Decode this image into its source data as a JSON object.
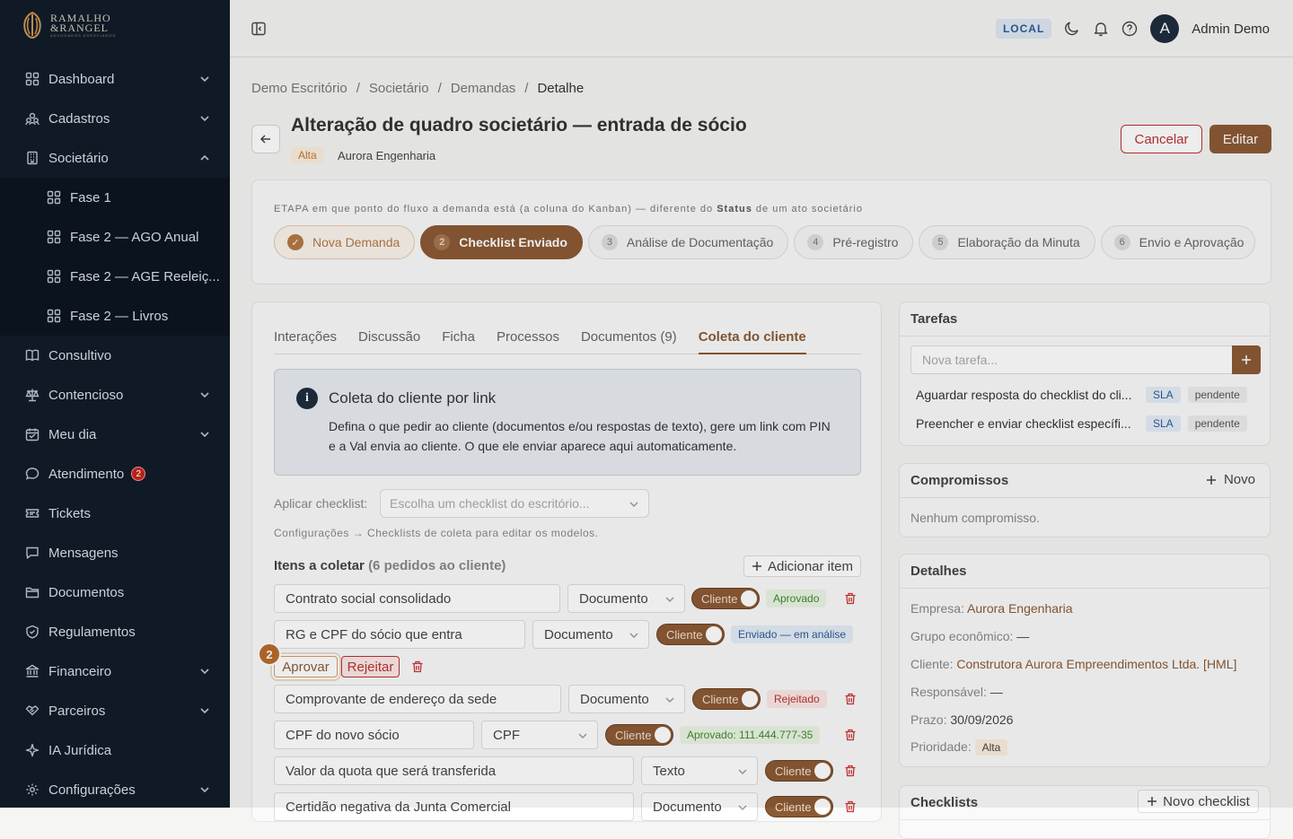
{
  "brand": {
    "line1": "RAMALHO",
    "line2": "&RANGEL",
    "line3": "ADVOGADOS ASSOCIADOS"
  },
  "sidebar": {
    "items": [
      {
        "label": "Dashboard",
        "icon": "grid-icon",
        "chevron": "down"
      },
      {
        "label": "Cadastros",
        "icon": "users-icon",
        "chevron": "down"
      },
      {
        "label": "Societário",
        "icon": "building-icon",
        "chevron": "up"
      }
    ],
    "sub_items": [
      {
        "label": "Fase 1"
      },
      {
        "label": "Fase 2 — AGO Anual"
      },
      {
        "label": "Fase 2 — AGE Reeleiç..."
      },
      {
        "label": "Fase 2 — Livros"
      }
    ],
    "items_after": [
      {
        "label": "Consultivo",
        "icon": "book-icon"
      },
      {
        "label": "Contencioso",
        "icon": "scale-icon",
        "chevron": "down"
      },
      {
        "label": "Meu dia",
        "icon": "calendar-icon",
        "chevron": "down"
      },
      {
        "label": "Atendimento",
        "icon": "chat-icon",
        "badge": "2"
      },
      {
        "label": "Tickets",
        "icon": "ticket-icon"
      },
      {
        "label": "Mensagens",
        "icon": "message-icon"
      },
      {
        "label": "Documentos",
        "icon": "folder-icon"
      },
      {
        "label": "Regulamentos",
        "icon": "shield-icon"
      },
      {
        "label": "Financeiro",
        "icon": "bank-icon",
        "chevron": "down"
      },
      {
        "label": "Parceiros",
        "icon": "handshake-icon",
        "chevron": "down"
      },
      {
        "label": "IA Jurídica",
        "icon": "sparkle-icon"
      },
      {
        "label": "Configurações",
        "icon": "gear-icon",
        "chevron": "down"
      }
    ]
  },
  "topbar": {
    "env_badge": "LOCAL",
    "avatar_letter": "A",
    "user_name": "Admin Demo"
  },
  "breadcrumb": [
    "Demo Escritório",
    "Societário",
    "Demandas",
    "Detalhe"
  ],
  "page": {
    "title": "Alteração de quadro societário — entrada de sócio",
    "priority": "Alta",
    "company": "Aurora Engenharia",
    "cancel_label": "Cancelar",
    "edit_label": "Editar"
  },
  "stage": {
    "label_prefix": "ETAPA",
    "label_text": "em que ponto do fluxo a demanda está (a coluna do Kanban) — diferente do",
    "label_bold": "Status",
    "label_suffix": "de um ato societário",
    "steps": [
      {
        "num": "✓",
        "label": "Nova Demanda",
        "state": "done"
      },
      {
        "num": "2",
        "label": "Checklist Enviado",
        "state": "active"
      },
      {
        "num": "3",
        "label": "Análise de Documentação",
        "state": "todo"
      },
      {
        "num": "4",
        "label": "Pré-registro",
        "state": "todo"
      },
      {
        "num": "5",
        "label": "Elaboração da Minuta",
        "state": "todo"
      },
      {
        "num": "6",
        "label": "Envio e Aprovação",
        "state": "todo"
      }
    ]
  },
  "tabs": [
    {
      "label": "Interações"
    },
    {
      "label": "Discussão"
    },
    {
      "label": "Ficha"
    },
    {
      "label": "Processos"
    },
    {
      "label": "Documentos (9)"
    },
    {
      "label": "Coleta do cliente",
      "active": true
    }
  ],
  "info": {
    "title": "Coleta do cliente por link",
    "text": "Defina o que pedir ao cliente (documentos e/ou respostas de texto), gere um link com PIN e a Val envia ao cliente. O que ele enviar aparece aqui automaticamente."
  },
  "checklist": {
    "apply_label": "Aplicar checklist:",
    "apply_placeholder": "Escolha um checklist do escritório...",
    "config_note": "Configurações → Checklists de coleta para editar os modelos.",
    "items_title": "Itens a coletar",
    "items_count": "(6 pedidos ao cliente)",
    "add_label": "Adicionar item",
    "toggle_label": "Cliente",
    "approve_label": "Aprovar",
    "reject_label": "Rejeitar",
    "step_badge": "2",
    "items": [
      {
        "name": "Contrato social consolidado",
        "type": "Documento",
        "status": "Aprovado"
      },
      {
        "name": "RG e CPF do sócio que entra",
        "type": "Documento",
        "status": "Enviado — em análise"
      },
      {
        "name": "Comprovante de endereço da sede",
        "type": "Documento",
        "status": "Rejeitado"
      },
      {
        "name": "CPF do novo sócio",
        "type": "CPF",
        "status": "Aprovado: 111.444.777-35"
      },
      {
        "name": "Valor da quota que será transferida",
        "type": "Texto",
        "status": ""
      },
      {
        "name": "Certidão negativa da Junta Comercial",
        "type": "Documento",
        "status": ""
      }
    ]
  },
  "tarefas": {
    "title": "Tarefas",
    "input_placeholder": "Nova tarefa...",
    "items": [
      {
        "text": "Aguardar resposta do checklist do cli...",
        "sla": "SLA",
        "status": "pendente"
      },
      {
        "text": "Preencher e enviar checklist específi...",
        "sla": "SLA",
        "status": "pendente"
      }
    ]
  },
  "compromissos": {
    "title": "Compromissos",
    "new_label": "Novo",
    "empty": "Nenhum compromisso."
  },
  "detalhes": {
    "title": "Detalhes",
    "empresa_label": "Empresa:",
    "empresa": "Aurora Engenharia",
    "grupo_label": "Grupo econômico:",
    "grupo": "—",
    "cliente_label": "Cliente:",
    "cliente": "Construtora Aurora Empreendimentos Ltda. [HML]",
    "responsavel_label": "Responsável:",
    "responsavel": "—",
    "prazo_label": "Prazo:",
    "prazo": "30/09/2026",
    "prioridade_label": "Prioridade:",
    "prioridade": "Alta"
  },
  "checklists": {
    "title": "Checklists",
    "new_label": "Novo checklist"
  }
}
